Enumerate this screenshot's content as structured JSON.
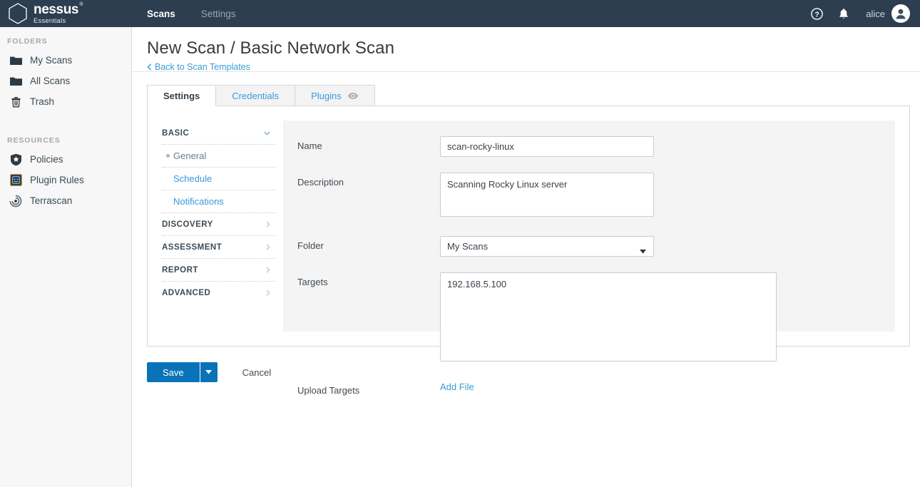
{
  "topbar": {
    "brand": {
      "name": "nessus",
      "registered": "®",
      "edition": "Essentials",
      "icon": "hexagon-logo-icon"
    },
    "nav": [
      {
        "label": "Scans",
        "active": true
      },
      {
        "label": "Settings",
        "active": false
      }
    ],
    "help_icon": "help-circle-icon",
    "notifications_icon": "bell-icon",
    "user": {
      "name": "alice",
      "avatar_icon": "user-avatar-icon"
    }
  },
  "sidebar": {
    "folders_heading": "FOLDERS",
    "folders": [
      {
        "label": "My Scans",
        "icon": "folder-icon"
      },
      {
        "label": "All Scans",
        "icon": "folder-icon"
      },
      {
        "label": "Trash",
        "icon": "trash-icon"
      }
    ],
    "resources_heading": "RESOURCES",
    "resources": [
      {
        "label": "Policies",
        "icon": "shield-star-icon"
      },
      {
        "label": "Plugin Rules",
        "icon": "plugin-badge-icon"
      },
      {
        "label": "Terrascan",
        "icon": "terrascan-icon"
      }
    ]
  },
  "page": {
    "title": "New Scan / Basic Network Scan",
    "back_link": "Back to Scan Templates",
    "back_icon": "chevron-left-icon"
  },
  "tabs": [
    {
      "label": "Settings",
      "active": true
    },
    {
      "label": "Credentials",
      "active": false
    },
    {
      "label": "Plugins",
      "active": false,
      "icon": "eye-icon"
    }
  ],
  "settings_nav": [
    {
      "label": "BASIC",
      "type": "group",
      "expanded": true,
      "icon": "chevron-down-icon"
    },
    {
      "label": "General",
      "type": "sub",
      "active": true
    },
    {
      "label": "Schedule",
      "type": "sub",
      "active": false
    },
    {
      "label": "Notifications",
      "type": "sub",
      "active": false
    },
    {
      "label": "DISCOVERY",
      "type": "group",
      "expanded": false,
      "icon": "chevron-right-icon"
    },
    {
      "label": "ASSESSMENT",
      "type": "group",
      "expanded": false,
      "icon": "chevron-right-icon"
    },
    {
      "label": "REPORT",
      "type": "group",
      "expanded": false,
      "icon": "chevron-right-icon"
    },
    {
      "label": "ADVANCED",
      "type": "group",
      "expanded": false,
      "icon": "chevron-right-icon"
    }
  ],
  "form": {
    "name": {
      "label": "Name",
      "value": "scan-rocky-linux",
      "placeholder": ""
    },
    "description": {
      "label": "Description",
      "value": "Scanning Rocky Linux server",
      "placeholder": ""
    },
    "folder": {
      "label": "Folder",
      "value": "My Scans",
      "caret_icon": "caret-down-icon"
    },
    "targets": {
      "label": "Targets",
      "value": "192.168.5.100",
      "placeholder": ""
    },
    "upload_targets": {
      "label": "Upload Targets",
      "link": "Add File"
    }
  },
  "actions": {
    "save": "Save",
    "save_caret_icon": "caret-down-icon",
    "cancel": "Cancel"
  },
  "colors": {
    "header_bg": "#2c3e50",
    "accent_blue": "#0a73b8",
    "link_blue": "#3a9ad9",
    "panel_gray": "#f4f4f4",
    "sidebar_bg": "#f7f7f7"
  }
}
